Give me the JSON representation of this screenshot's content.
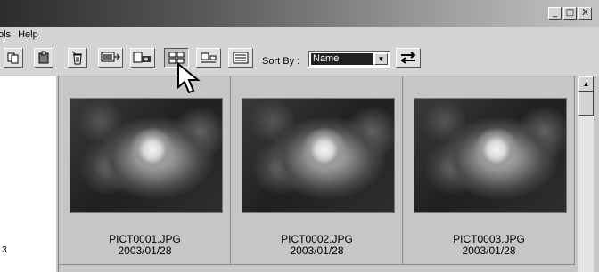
{
  "window": {
    "controls": [
      "_",
      "□",
      "X"
    ]
  },
  "menu": {
    "items": [
      "ols",
      "Help"
    ]
  },
  "toolbar": {
    "buttons": [
      "copy-icon",
      "paste-icon",
      "delete-icon",
      "slideshow-icon",
      "camera-icon",
      "thumbnail-view-icon",
      "detail-view-icon",
      "list-view-icon",
      "swap-order-icon"
    ],
    "sort_label": "Sort By :",
    "sort_value": "Name"
  },
  "left_panel": {
    "number": "3"
  },
  "thumbnails": [
    {
      "filename": "PICT0001.JPG",
      "date": "2003/01/28"
    },
    {
      "filename": "PICT0002.JPG",
      "date": "2003/01/28"
    },
    {
      "filename": "PICT0003.JPG",
      "date": "2003/01/28"
    }
  ]
}
